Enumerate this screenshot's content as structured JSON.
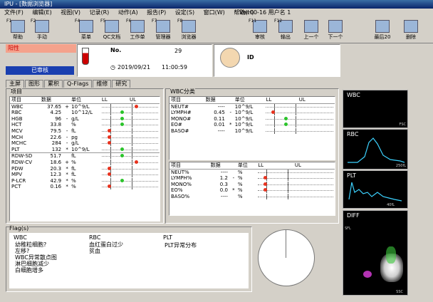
{
  "window": {
    "title": "IPU - [数据浏览器]"
  },
  "menu": {
    "items": [
      "文件(F)",
      "编辑(E)",
      "视图(V)",
      "记录(R)",
      "动作(A)",
      "报告(P)",
      "设定(S)",
      "窗口(W)",
      "帮助(H)"
    ],
    "version": "Ver.00-16 用户名 1"
  },
  "toolbar": {
    "buttons": [
      {
        "key": "F1",
        "label": "帮助"
      },
      {
        "key": "F2",
        "label": "手动"
      },
      {
        "key": "F4",
        "label": "菜单"
      },
      {
        "key": "F5",
        "label": "QC文档"
      },
      {
        "key": "F6",
        "label": "工作单"
      },
      {
        "key": "F7",
        "label": "管理器"
      },
      {
        "key": "F8",
        "label": "浏览器"
      },
      {
        "key": "F11",
        "label": "审核"
      },
      {
        "key": "F12",
        "label": "输出"
      },
      {
        "key": "",
        "label": "上一个"
      },
      {
        "key": "",
        "label": "下一个"
      },
      {
        "key": "",
        "label": "最后20"
      },
      {
        "key": "",
        "label": "删除"
      }
    ]
  },
  "sample": {
    "status": "阳性",
    "review": "已审核",
    "no_label": "No.",
    "no": "29",
    "date": "2019/09/21",
    "time": "11:00:59",
    "id_label": "ID"
  },
  "tabs": [
    "主屏",
    "图形",
    "累积",
    "Q-Flags",
    "维修",
    "研究"
  ],
  "main_table": {
    "section": "项目",
    "headers": [
      "项目",
      "数据",
      "",
      "单位",
      "LL",
      "UL"
    ],
    "rows": [
      {
        "item": "WBC",
        "value": "37.65",
        "flag": "+",
        "unit": "10^9/L",
        "color": "#e8321e"
      },
      {
        "item": "RBC",
        "value": "4.25",
        "flag": "",
        "unit": "10^12/L",
        "color": "#2bc42b"
      },
      {
        "item": "HGB",
        "value": "96",
        "flag": "-",
        "unit": "g/L",
        "color": "#2bc42b"
      },
      {
        "item": "HCT",
        "value": "33.8",
        "flag": "",
        "unit": "%",
        "color": "#2bc42b"
      },
      {
        "item": "MCV",
        "value": "79.5",
        "flag": "-",
        "unit": "fL",
        "color": "#e8321e"
      },
      {
        "item": "MCH",
        "value": "22.6",
        "flag": "-",
        "unit": "pg",
        "color": "#e8321e"
      },
      {
        "item": "MCHC",
        "value": "284",
        "flag": "-",
        "unit": "g/L",
        "color": "#e8321e"
      },
      {
        "item": "PLT",
        "value": "132",
        "flag": "*",
        "unit": "10^9/L",
        "color": "#2bc42b"
      },
      {
        "item": "RDW-SD",
        "value": "51.7",
        "flag": "",
        "unit": "fL",
        "color": "#2bc42b"
      },
      {
        "item": "RDW-CV",
        "value": "18.6",
        "flag": "+",
        "unit": "%",
        "color": "#e8321e"
      },
      {
        "item": "PDW",
        "value": "20.3",
        "flag": "*",
        "unit": "fL",
        "color": "#e8321e"
      },
      {
        "item": "MPV",
        "value": "12.3",
        "flag": "*",
        "unit": "fL",
        "color": "#e8321e"
      },
      {
        "item": "P-LCR",
        "value": "42.9",
        "flag": "*",
        "unit": "%",
        "color": "#2bc42b"
      },
      {
        "item": "PCT",
        "value": "0.16",
        "flag": "*",
        "unit": "%",
        "color": "#e8321e"
      }
    ]
  },
  "wbc_table": {
    "section": "WBC分类",
    "headers": [
      "项目",
      "数据",
      "",
      "单位",
      "LL",
      "UL"
    ],
    "abs_rows": [
      {
        "item": "NEUT#",
        "value": "----",
        "flag": "",
        "unit": "10^9/L",
        "color": ""
      },
      {
        "item": "LYMPH#",
        "value": "0.45",
        "flag": "-",
        "unit": "10^9/L",
        "color": "#e8321e"
      },
      {
        "item": "MONO#",
        "value": "0.11",
        "flag": "",
        "unit": "10^9/L",
        "color": "#2bc42b"
      },
      {
        "item": "EO#",
        "value": "0.01",
        "flag": "*",
        "unit": "10^9/L",
        "color": "#2bc42b"
      },
      {
        "item": "BASO#",
        "value": "----",
        "flag": "",
        "unit": "10^9/L",
        "color": ""
      }
    ],
    "pct_rows": [
      {
        "item": "NEUT%",
        "value": "----",
        "flag": "",
        "unit": "%",
        "color": ""
      },
      {
        "item": "LYMPH%",
        "value": "1.2",
        "flag": "-",
        "unit": "%",
        "color": "#e8321e"
      },
      {
        "item": "MONO%",
        "value": "0.3",
        "flag": "",
        "unit": "%",
        "color": "#e8321e"
      },
      {
        "item": "EO%",
        "value": "0.0",
        "flag": "*",
        "unit": "%",
        "color": "#e8321e"
      },
      {
        "item": "BASO%",
        "value": "----",
        "flag": "",
        "unit": "%",
        "color": ""
      }
    ]
  },
  "flags": {
    "title": "Flag(s)",
    "wbc_label": "WBC",
    "wbc": [
      "幼稚粒细胞?",
      "左移?",
      "WBC异常散点图",
      "淋巴细胞减少",
      "白细胞增多"
    ],
    "rbc_label": "RBC",
    "rbc": [
      "血红蛋白过少",
      "贫血"
    ],
    "plt_label": "PLT",
    "plt": [
      "PLT异常分布"
    ]
  },
  "graphs": {
    "wbc": "WBC",
    "wbc_axis": "FSC",
    "rbc": "RBC",
    "rbc_axis": "250fL",
    "plt": "PLT",
    "plt_axis": "40fL",
    "diff": "DIFF",
    "diff_xaxis": "SSC",
    "diff_yaxis": "SFL"
  }
}
